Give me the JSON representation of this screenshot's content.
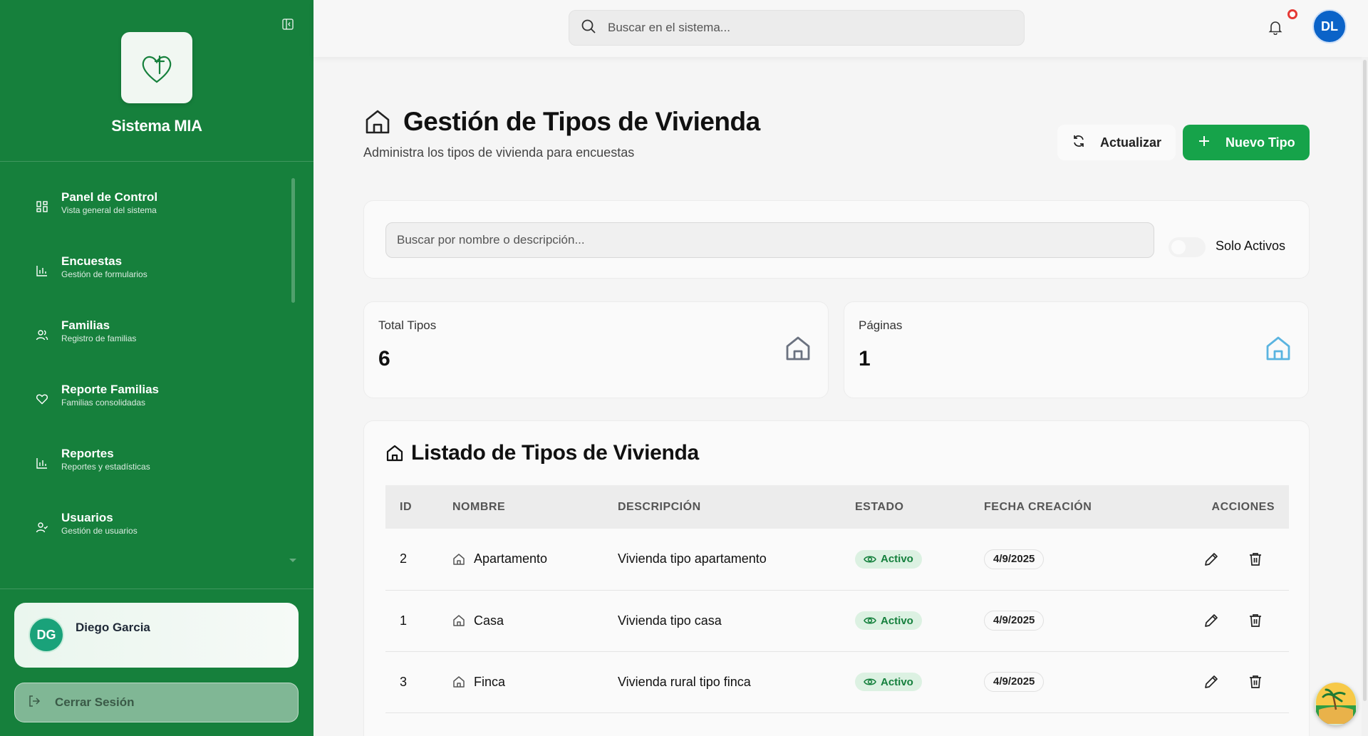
{
  "sidebar": {
    "app_name": "Sistema MIA",
    "items": [
      {
        "title": "Panel de Control",
        "subtitle": "Vista general del sistema",
        "icon": "dashboard-icon"
      },
      {
        "title": "Encuestas",
        "subtitle": "Gestión de formularios",
        "icon": "bar-chart-icon"
      },
      {
        "title": "Familias",
        "subtitle": "Registro de familias",
        "icon": "users-icon"
      },
      {
        "title": "Reporte Familias",
        "subtitle": "Familias consolidadas",
        "icon": "heart-icon"
      },
      {
        "title": "Reportes",
        "subtitle": "Reportes y estadísticas",
        "icon": "bar-chart-icon"
      },
      {
        "title": "Usuarios",
        "subtitle": "Gestión de usuarios",
        "icon": "user-check-icon"
      }
    ],
    "user": {
      "initials": "DG",
      "name": "Diego Garcia"
    },
    "logout_label": "Cerrar Sesión"
  },
  "topbar": {
    "search_placeholder": "Buscar en el sistema...",
    "avatar_initials": "DL"
  },
  "header": {
    "title": "Gestión de Tipos de Vivienda",
    "subtitle": "Administra los tipos de vivienda para encuestas",
    "refresh_label": "Actualizar",
    "new_label": "Nuevo Tipo"
  },
  "filters": {
    "search_placeholder": "Buscar por nombre o descripción...",
    "toggle_label": "Solo Activos"
  },
  "stats": [
    {
      "label": "Total Tipos",
      "value": "6"
    },
    {
      "label": "Páginas",
      "value": "1"
    }
  ],
  "list": {
    "title": "Listado de Tipos de Vivienda",
    "columns": [
      "ID",
      "NOMBRE",
      "DESCRIPCIÓN",
      "ESTADO",
      "FECHA CREACIÓN",
      "ACCIONES"
    ],
    "rows": [
      {
        "id": "2",
        "name": "Apartamento",
        "description": "Vivienda tipo apartamento",
        "status": "Activo",
        "date": "4/9/2025"
      },
      {
        "id": "1",
        "name": "Casa",
        "description": "Vivienda tipo casa",
        "status": "Activo",
        "date": "4/9/2025"
      },
      {
        "id": "3",
        "name": "Finca",
        "description": "Vivienda rural tipo finca",
        "status": "Activo",
        "date": "4/9/2025"
      }
    ]
  },
  "colors": {
    "sidebar": "#16803c",
    "primary_button": "#16a34a",
    "avatar_blue": "#0b63c8",
    "notification": "#e53935"
  }
}
